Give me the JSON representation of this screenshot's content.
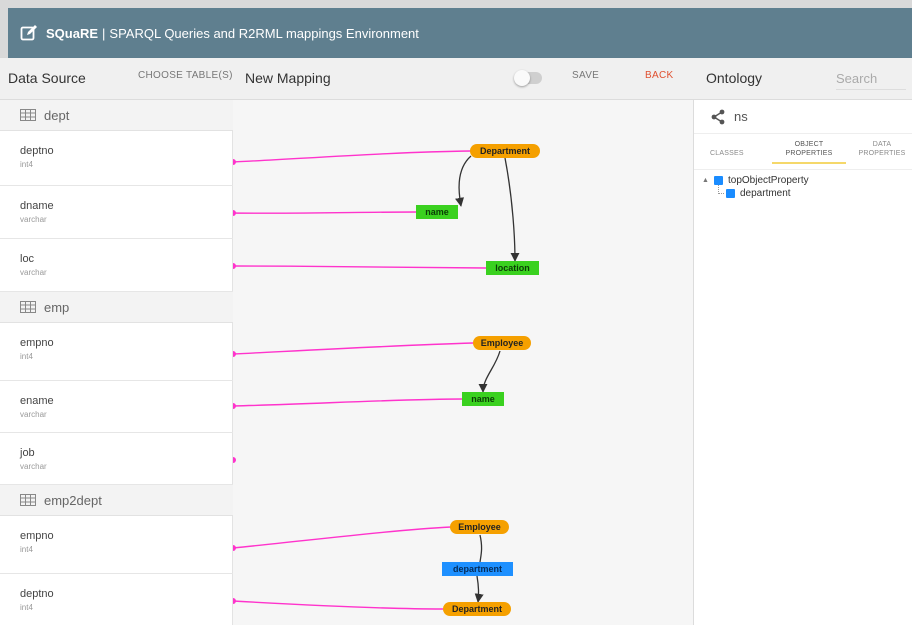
{
  "app": {
    "brand": "SQuaRE",
    "separator": "|",
    "title": "SPARQL Queries and R2RML mappings Environment"
  },
  "toolbar": {
    "data_source_label": "Data Source",
    "choose_tables_label": "CHOOSE TABLE(S)",
    "new_mapping_label": "New Mapping",
    "save_label": "SAVE",
    "back_label": "BACK",
    "ontology_label": "Ontology",
    "search_placeholder": "Search"
  },
  "tables": [
    {
      "name": "dept",
      "columns": [
        {
          "name": "deptno",
          "type": "int4"
        },
        {
          "name": "dname",
          "type": "varchar"
        },
        {
          "name": "loc",
          "type": "varchar"
        }
      ]
    },
    {
      "name": "emp",
      "columns": [
        {
          "name": "empno",
          "type": "int4"
        },
        {
          "name": "ename",
          "type": "varchar"
        },
        {
          "name": "job",
          "type": "varchar"
        }
      ]
    },
    {
      "name": "emp2dept",
      "columns": [
        {
          "name": "empno",
          "type": "int4"
        },
        {
          "name": "deptno",
          "type": "int4"
        }
      ]
    }
  ],
  "mapping_nodes": [
    {
      "label": "Department",
      "kind": "class"
    },
    {
      "label": "name",
      "kind": "data-property"
    },
    {
      "label": "location",
      "kind": "data-property"
    },
    {
      "label": "Employee",
      "kind": "class"
    },
    {
      "label": "name",
      "kind": "data-property"
    },
    {
      "label": "Employee",
      "kind": "class"
    },
    {
      "label": "department",
      "kind": "object-property"
    },
    {
      "label": "Department",
      "kind": "class"
    }
  ],
  "ontology": {
    "namespace": "ns",
    "tabs": [
      {
        "line1": "CLASSES",
        "line2": ""
      },
      {
        "line1": "OBJECT",
        "line2": "PROPERTIES"
      },
      {
        "line1": "DATA",
        "line2": "PROPERTIES"
      }
    ],
    "active_tab": "OBJECT PROPERTIES",
    "tree": {
      "root": "topObjectProperty",
      "children": [
        "department"
      ]
    }
  },
  "colors": {
    "header_bg": "#5f7f8f",
    "class_node": "#f5a000",
    "data_property_node": "#3ad11f",
    "object_property_node": "#1e90ff",
    "link_line": "#ff33cc",
    "back_link": "#e05030"
  }
}
